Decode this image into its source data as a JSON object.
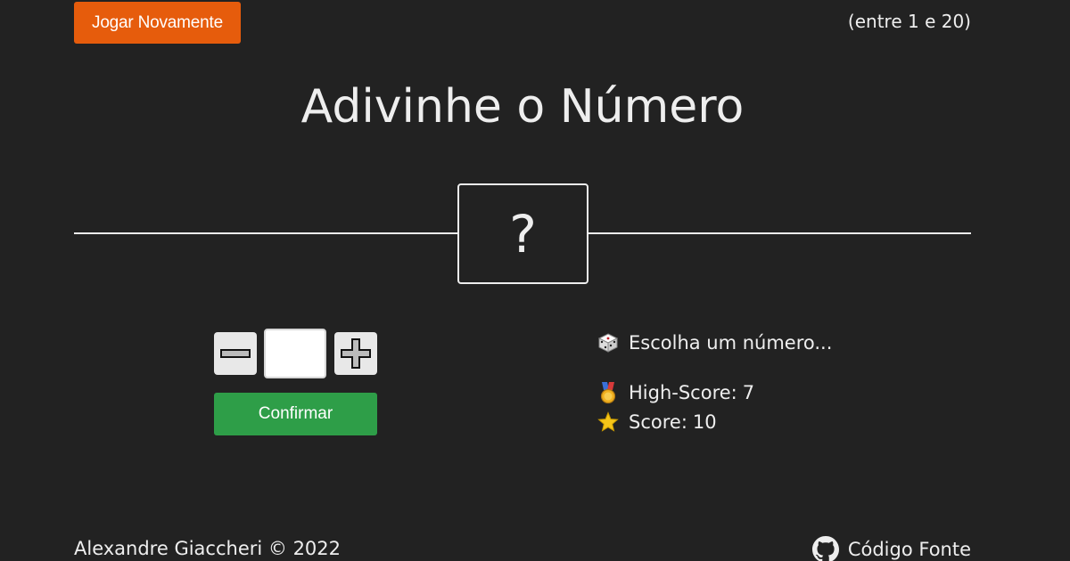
{
  "header": {
    "play_again_label": "Jogar Novamente",
    "range_hint": "(entre 1 e 20)"
  },
  "game": {
    "title": "Adivinhe o Número",
    "secret_placeholder": "?",
    "guess_value": "",
    "confirm_label": "Confirmar"
  },
  "status": {
    "message": "Escolha um número...",
    "high_score_label": "High-Score:",
    "high_score_value": "7",
    "score_label": "Score:",
    "score_value": "10"
  },
  "icons": {
    "message_icon": "dice-icon",
    "high_score_icon": "medal-icon",
    "score_icon": "star-icon",
    "source_icon": "github-icon"
  },
  "footer": {
    "author": "Alexandre Giaccheri © 2022",
    "source_label": "Código Fonte"
  },
  "colors": {
    "background": "#222222",
    "text": "#eeeeee",
    "play_again_button": "#e65c0c",
    "confirm_button": "#2e9e48",
    "stepper_button": "#e8e8e8"
  }
}
